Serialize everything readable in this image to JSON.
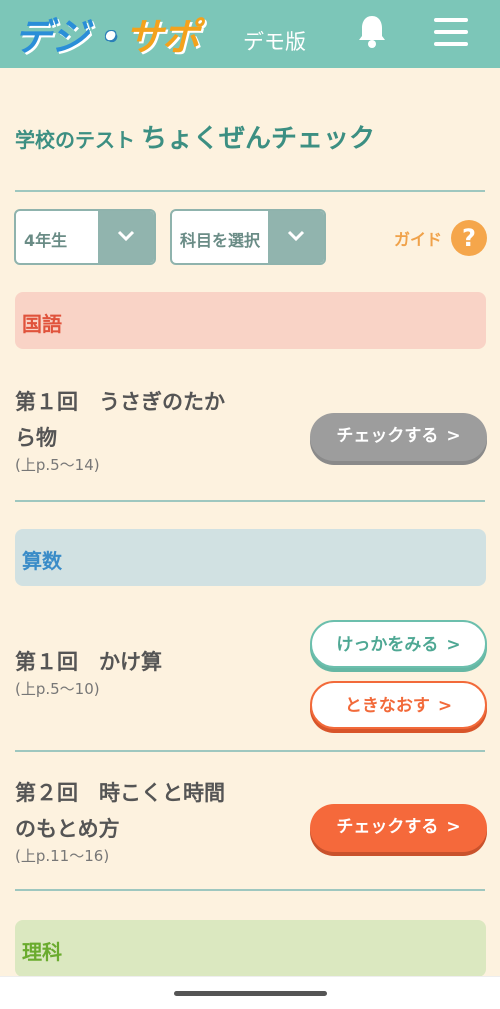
{
  "header": {
    "logo": "デジ・サポ",
    "demo_label": "デモ版"
  },
  "page": {
    "title_small": "学校のテスト",
    "title_big": "ちょくぜんチェック"
  },
  "filters": {
    "grade": "4年生",
    "subject": "科目を選択",
    "guide_label": "ガイド",
    "guide_icon": "?"
  },
  "subjects": [
    {
      "name": "国語",
      "color": "#f9d3c6",
      "text_color": "#e0533c",
      "lessons": [
        {
          "line1": "第１回　うさぎのたか",
          "line2": "ら物",
          "pages": "(上p.5〜14)",
          "buttons": [
            "チェックする"
          ]
        }
      ]
    },
    {
      "name": "算数",
      "color": "#d1e1e2",
      "text_color": "#3a8cc8",
      "lessons": [
        {
          "line1": "第１回　かけ算",
          "pages": "(上p.5〜10)",
          "buttons": [
            "けっかをみる",
            "ときなおす"
          ]
        },
        {
          "line1": "第２回　時こくと時間",
          "line2": "のもとめ方",
          "pages": "(上p.11〜16)",
          "buttons": [
            "チェックする"
          ]
        }
      ]
    },
    {
      "name": "理科",
      "color": "#dbe8c0",
      "text_color": "#6aab2e",
      "lessons": []
    }
  ]
}
